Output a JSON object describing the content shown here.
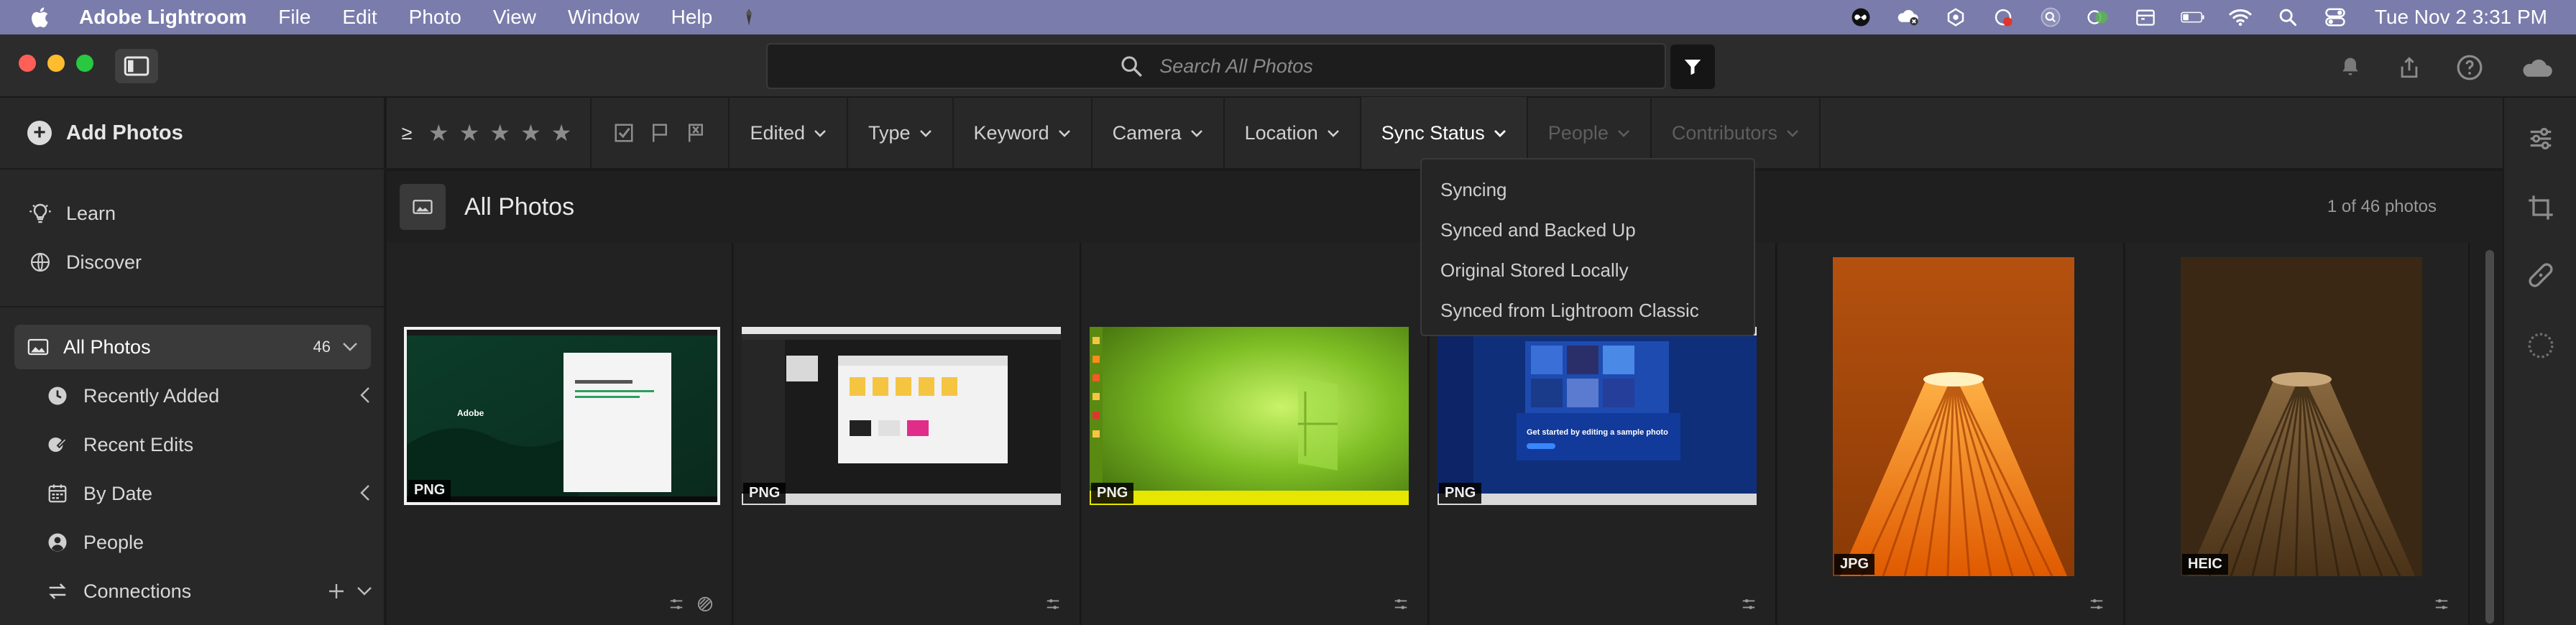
{
  "menubar": {
    "app_name": "Adobe Lightroom",
    "items": [
      "File",
      "Edit",
      "Photo",
      "View",
      "Window",
      "Help"
    ],
    "clock": "Tue Nov 2  3:31 PM"
  },
  "search": {
    "placeholder": "Search All Photos"
  },
  "sidebar": {
    "add_photos": "Add Photos",
    "learn": "Learn",
    "discover": "Discover",
    "all_photos": "All Photos",
    "all_photos_count": "46",
    "items": [
      {
        "label": "Recently Added",
        "icon": "clock-icon"
      },
      {
        "label": "Recent Edits",
        "icon": "edit-brush-icon"
      },
      {
        "label": "By Date",
        "icon": "calendar-icon"
      },
      {
        "label": "People",
        "icon": "person-icon"
      },
      {
        "label": "Connections",
        "icon": "connections-icon"
      }
    ]
  },
  "filterbar": {
    "rating_op": "≥",
    "items": [
      {
        "label": "Edited",
        "state": "normal"
      },
      {
        "label": "Type",
        "state": "normal"
      },
      {
        "label": "Keyword",
        "state": "normal"
      },
      {
        "label": "Camera",
        "state": "normal"
      },
      {
        "label": "Location",
        "state": "normal"
      },
      {
        "label": "Sync Status",
        "state": "active"
      },
      {
        "label": "People",
        "state": "disabled"
      },
      {
        "label": "Contributors",
        "state": "disabled"
      }
    ]
  },
  "dropdown": {
    "options": [
      "Syncing",
      "Synced and Backed Up",
      "Original Stored Locally",
      "Synced from Lightroom Classic"
    ]
  },
  "content": {
    "title": "All Photos",
    "count_text": "1 of 46 photos",
    "photos": [
      {
        "type": "PNG",
        "description": "adobe-signin-screenshot"
      },
      {
        "type": "PNG",
        "description": "file-explorer-screenshot"
      },
      {
        "type": "PNG",
        "description": "windows-wallpaper"
      },
      {
        "type": "PNG",
        "description": "lightroom-screenshot"
      },
      {
        "type": "JPG",
        "description": "orange-lampshade"
      },
      {
        "type": "HEIC",
        "description": "brown-lampshade"
      }
    ]
  },
  "colors": {
    "menubar_bg": "#7a7cab",
    "window_bg": "#282828",
    "content_bg": "#1f1f1f",
    "close": "#fe5f57",
    "minimize": "#febc2e",
    "maximize": "#28c840"
  }
}
